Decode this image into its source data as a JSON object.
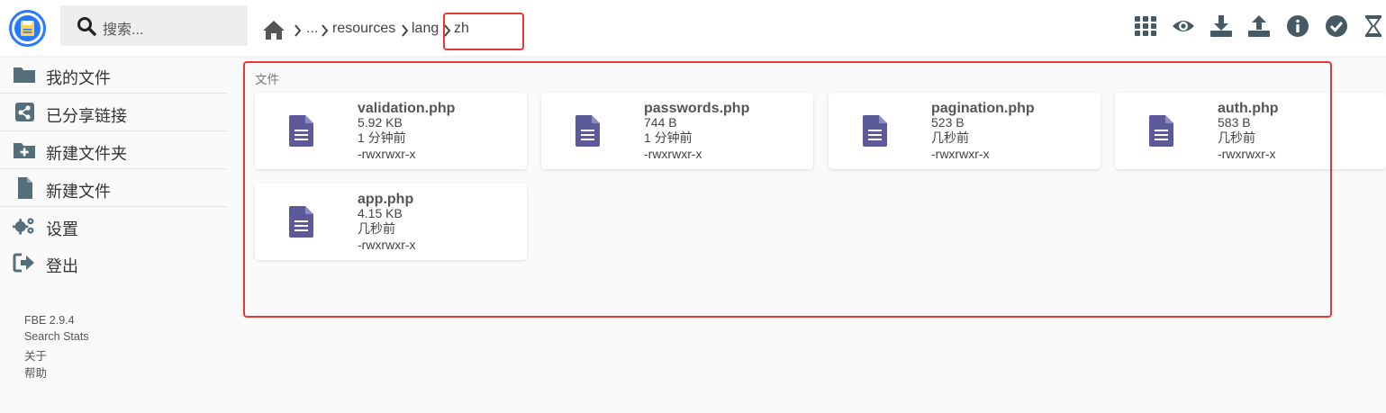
{
  "header": {
    "search_placeholder": "搜索...",
    "breadcrumb": [
      "...",
      "resources",
      "lang",
      "zh"
    ]
  },
  "sidebar": {
    "items": [
      {
        "label": "我的文件",
        "icon": "folder-icon"
      },
      {
        "label": "已分享链接",
        "icon": "share-icon"
      },
      {
        "label": "新建文件夹",
        "icon": "new-folder-icon"
      },
      {
        "label": "新建文件",
        "icon": "new-file-icon"
      },
      {
        "label": "设置",
        "icon": "gears-icon"
      },
      {
        "label": "登出",
        "icon": "logout-icon"
      }
    ],
    "footer": [
      "FBE 2.9.4",
      "Search Stats",
      "关于",
      "帮助"
    ]
  },
  "main": {
    "section_label": "文件",
    "files": [
      {
        "name": "validation.php",
        "size": "5.92 KB",
        "modified": "1 分钟前",
        "perms": "-rwxrwxr-x"
      },
      {
        "name": "passwords.php",
        "size": "744 B",
        "modified": "1 分钟前",
        "perms": "-rwxrwxr-x"
      },
      {
        "name": "pagination.php",
        "size": "523 B",
        "modified": "几秒前",
        "perms": "-rwxrwxr-x"
      },
      {
        "name": "auth.php",
        "size": "583 B",
        "modified": "几秒前",
        "perms": "-rwxrwxr-x"
      },
      {
        "name": "app.php",
        "size": "4.15 KB",
        "modified": "几秒前",
        "perms": "-rwxrwxr-x"
      }
    ]
  },
  "colors": {
    "accent": "#2979ff",
    "file_icon": "#5c5a99",
    "highlight": "#e53935",
    "icon_dark": "#546e7a"
  }
}
